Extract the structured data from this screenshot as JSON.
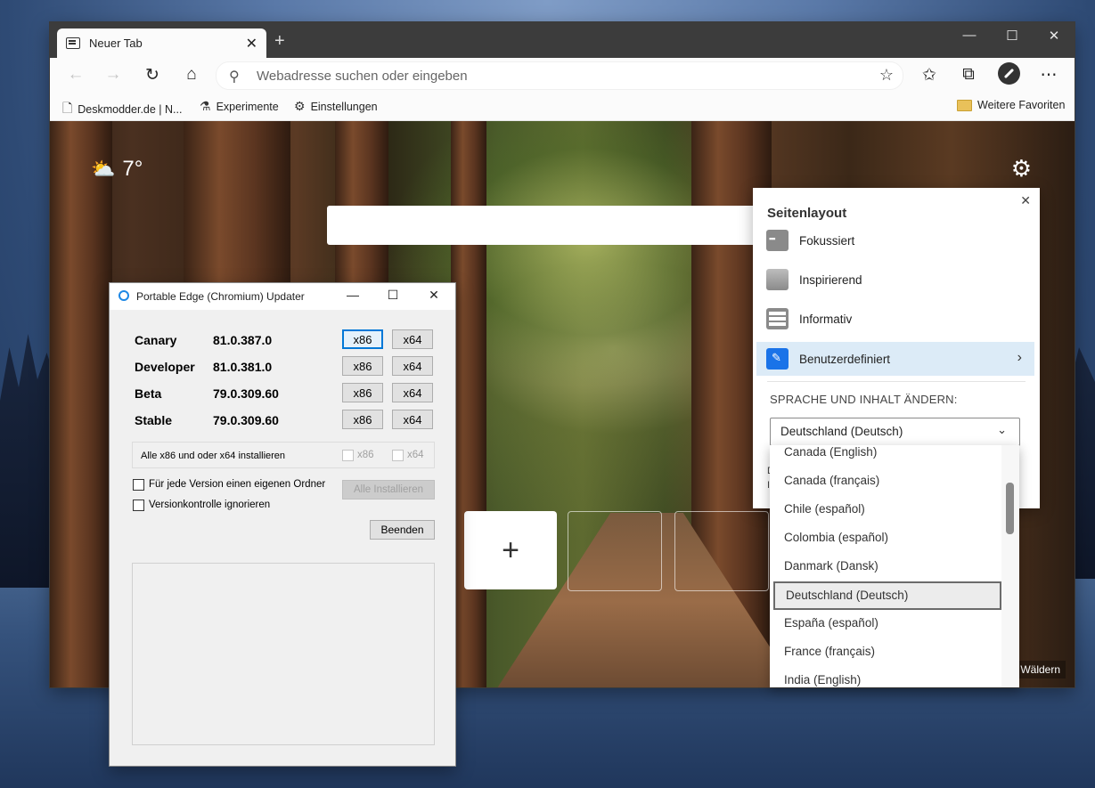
{
  "browser": {
    "tab_title": "Neuer Tab",
    "address_placeholder": "Webadresse suchen oder eingeben",
    "favorites": [
      {
        "label": "Deskmodder.de | N..."
      },
      {
        "label": "Experimente"
      },
      {
        "label": "Einstellungen"
      }
    ],
    "more_favorites": "Weitere Favoriten"
  },
  "page": {
    "temperature": "7°",
    "credit": "Wäldern"
  },
  "layout_panel": {
    "title": "Seitenlayout",
    "options": [
      {
        "label": "Fokussiert"
      },
      {
        "label": "Inspirierend"
      },
      {
        "label": "Informativ"
      },
      {
        "label": "Benutzerdefiniert",
        "selected": true
      }
    ],
    "language_label": "SPRACHE UND INHALT ÄNDERN:",
    "language_value": "Deutschland (Deutsch)",
    "under_text_1": "D",
    "under_text_2": "I"
  },
  "language_list": {
    "items": [
      "Canada (English)",
      "Canada (français)",
      "Chile (español)",
      "Colombia (español)",
      "Danmark (Dansk)",
      "Deutschland (Deutsch)",
      "España (español)",
      "France (français)",
      "India (English)"
    ],
    "selected": "Deutschland (Deutsch)"
  },
  "updater": {
    "title": "Portable Edge (Chromium) Updater",
    "channels": [
      {
        "name": "Canary",
        "version": "81.0.387.0"
      },
      {
        "name": "Developer",
        "version": "81.0.381.0"
      },
      {
        "name": "Beta",
        "version": "79.0.309.60"
      },
      {
        "name": "Stable",
        "version": "79.0.309.60"
      }
    ],
    "x86_label": "x86",
    "x64_label": "x64",
    "install_all_text": "Alle x86 und oder x64 installieren",
    "own_folder_label": "Für jede Version einen eigenen Ordner",
    "ignore_version_label": "Versionkontrolle ignorieren",
    "install_all_button": "Alle Installieren",
    "exit_button": "Beenden"
  }
}
